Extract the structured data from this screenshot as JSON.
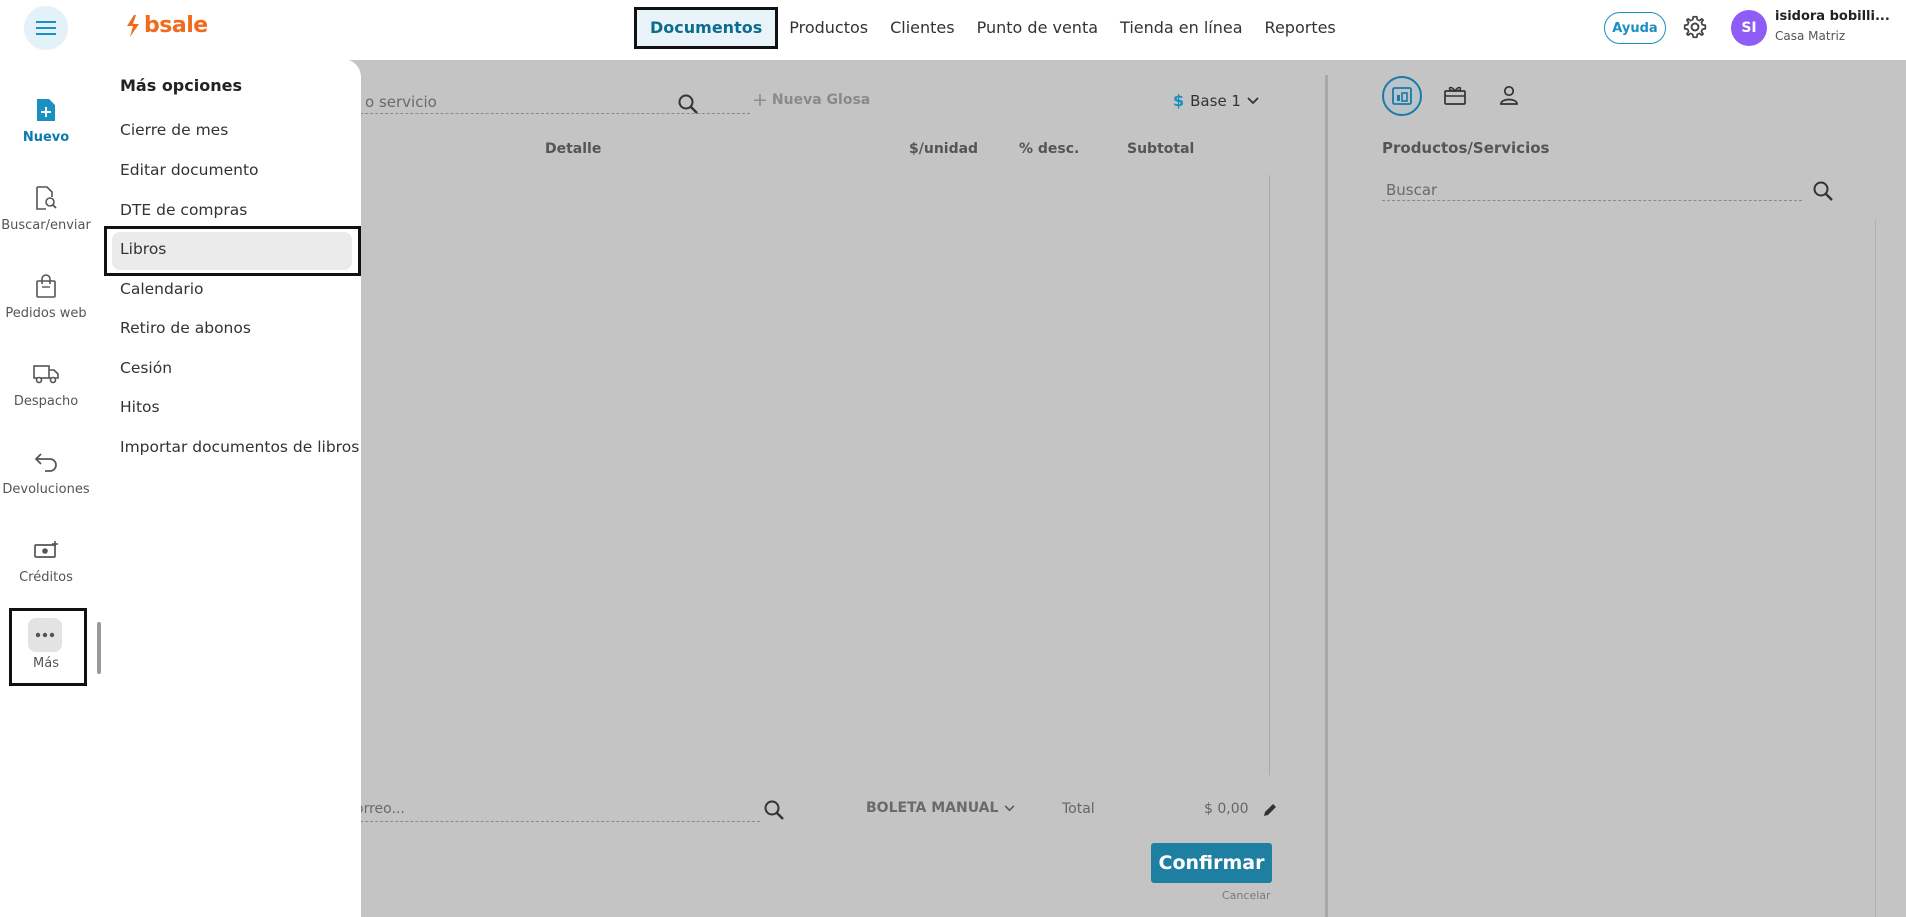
{
  "header": {
    "logo_text": "bsale",
    "nav": [
      "Documentos",
      "Productos",
      "Clientes",
      "Punto de venta",
      "Tienda en línea",
      "Reportes"
    ],
    "help_label": "Ayuda",
    "avatar_initials": "SI",
    "user_name": "isidora bobilli...",
    "user_branch": "Casa Matriz"
  },
  "rail": {
    "items": [
      {
        "label": "Nuevo",
        "icon": "new-document-icon"
      },
      {
        "label": "Buscar/enviar",
        "icon": "search-document-icon"
      },
      {
        "label": "Pedidos web",
        "icon": "shopping-bag-icon"
      },
      {
        "label": "Despacho",
        "icon": "truck-icon"
      },
      {
        "label": "Devoluciones",
        "icon": "return-arrow-icon"
      },
      {
        "label": "Créditos",
        "icon": "credit-money-icon"
      },
      {
        "label": "Más",
        "icon": "more-dots-icon"
      }
    ]
  },
  "drawer": {
    "title": "Más opciones",
    "items": [
      "Cierre de mes",
      "Editar documento",
      "DTE de compras",
      "Libros",
      "Calendario",
      "Retiro de abonos",
      "Cesión",
      "Hitos",
      "Importar documentos de libros"
    ]
  },
  "main": {
    "search_placeholder": "o servicio",
    "add_gloss_label": "Nueva Glosa",
    "currency_symbol": "$",
    "price_list": "Base 1",
    "columns": [
      "Detalle",
      "$/unidad",
      "% desc.",
      "Subtotal"
    ],
    "email_placeholder": "orreo...",
    "doc_type": "BOLETA MANUAL",
    "total_label": "Total",
    "total_value": "$ 0,00",
    "confirm_label": "Confirmar",
    "cancel_label": "Cancelar"
  },
  "right": {
    "section_title": "Productos/Servicios",
    "search_placeholder": "Buscar"
  },
  "colors": {
    "brand_orange": "#f26b1d",
    "accent_blue": "#0d7ab0",
    "confirm_blue": "#1e7fa3",
    "avatar_purple": "#8e5cf7"
  }
}
